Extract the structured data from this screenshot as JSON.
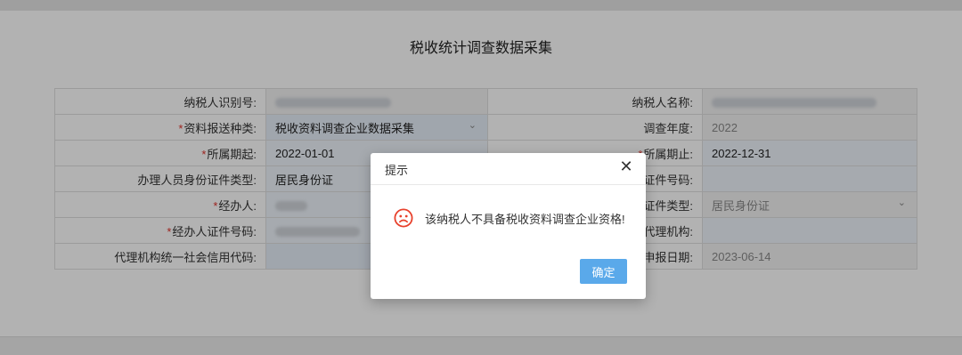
{
  "page": {
    "title": "税收统计调查数据采集"
  },
  "form": {
    "rows": [
      {
        "left_label": "纳税人识别号:",
        "left_required": false,
        "left_value": "",
        "right_label": "纳税人名称:",
        "right_required": false,
        "right_value": ""
      },
      {
        "left_label": "资料报送种类:",
        "left_required": true,
        "left_value": "税收资料调查企业数据采集",
        "right_label": "调查年度:",
        "right_required": false,
        "right_value": "2022"
      },
      {
        "left_label": "所属期起:",
        "left_required": true,
        "left_value": "2022-01-01",
        "right_label": "所属期止:",
        "right_required": true,
        "right_value": "2022-12-31"
      },
      {
        "left_label": "办理人员身份证件类型:",
        "left_required": false,
        "left_value": "居民身份证",
        "right_label": "证件号码:",
        "right_required": false,
        "right_value": ""
      },
      {
        "left_label": "经办人:",
        "left_required": true,
        "left_value": "",
        "right_label": "证件类型:",
        "right_required": false,
        "right_value": "居民身份证"
      },
      {
        "left_label": "经办人证件号码:",
        "left_required": true,
        "left_value": "",
        "right_label": "代理机构:",
        "right_required": false,
        "right_value": ""
      },
      {
        "left_label": "代理机构统一社会信用代码:",
        "left_required": false,
        "left_value": "",
        "right_label": "申报日期:",
        "right_required": false,
        "right_value": "2023-06-14"
      }
    ],
    "required_mark": "*"
  },
  "dialog": {
    "title": "提示",
    "close_glyph": "✕",
    "message": "该纳税人不具备税收资料调查企业资格!",
    "confirm_label": "确定",
    "icon": "sad-face-icon",
    "icon_color": "#e8412c",
    "button_color": "#5aa9ea"
  },
  "overlay": {
    "color": "#000000",
    "opacity": 0.3
  }
}
